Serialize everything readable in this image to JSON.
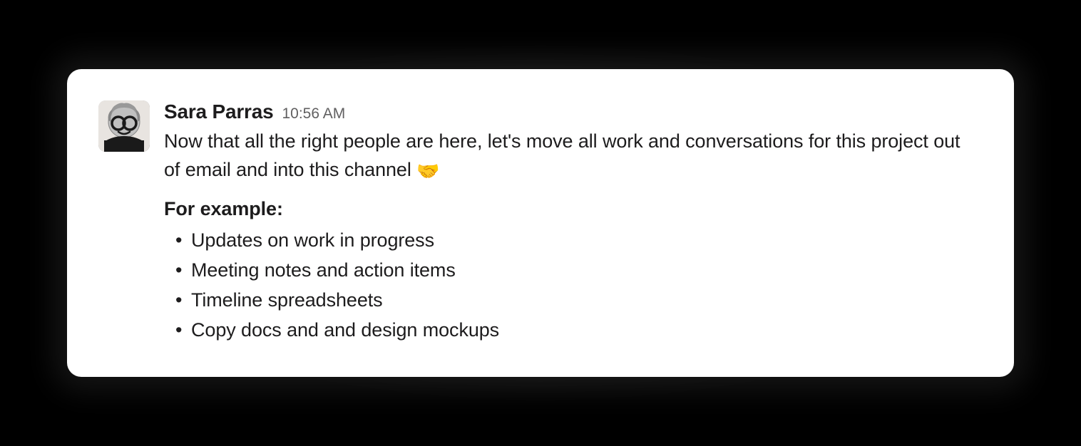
{
  "message": {
    "author": "Sara Parras",
    "timestamp": "10:56 AM",
    "body_text": "Now that all the right people are here, let's move all work and conversations for this project out of email and into this channel ",
    "emoji": "🤝",
    "examples_label": "For example:",
    "examples": [
      "Updates on work in progress",
      "Meeting notes and action items",
      "Timeline spreadsheets",
      "Copy docs and and design mockups"
    ]
  }
}
